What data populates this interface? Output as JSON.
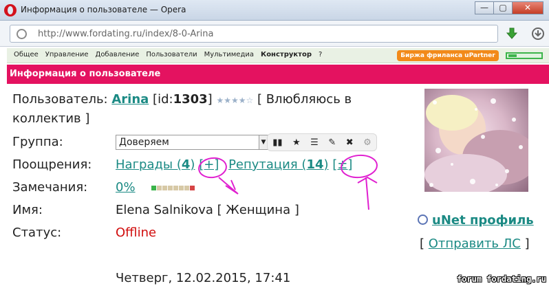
{
  "window": {
    "title": "Информация о пользователе — Opera",
    "buttons": {
      "minimize": "—",
      "maximize": "▢",
      "close": "✕"
    }
  },
  "address_bar": {
    "url": "http://www.fordating.ru/index/8-0-Arina"
  },
  "site_nav": {
    "items": [
      "Общее",
      "Управление",
      "Добавление",
      "Пользователи",
      "Мультимедиа",
      "Конструктор",
      "?"
    ],
    "freelance_label": "Биржа фриланса uPartner"
  },
  "page_header": "Информация о пользователе",
  "profile": {
    "user_label": "Пользователь:",
    "user_name": "Arina",
    "id_prefix": "[id:",
    "id_value": "1303",
    "id_suffix": "]",
    "stars": "★★★★☆",
    "status_line_1": "[ Влюбляюсь в",
    "status_line_2": "коллектив ]",
    "group_label": "Группа:",
    "group_value": "Доверяем",
    "rewards_label": "Поощрения:",
    "awards_text": "Награды (",
    "awards_count": "4",
    "awards_close": ")",
    "awards_add": "[+]",
    "reputation_text": "Репутация (",
    "reputation_count": "14",
    "reputation_close": ")",
    "reputation_adjust": "[±]",
    "remarks_label": "Замечания:",
    "remarks_value": "0%",
    "name_label": "Имя:",
    "name_value": "Elena Salnikova [ Женщина ]",
    "status_label": "Статус:",
    "status_value": "Offline",
    "date_value": "Четверг, 12.02.2015, 17:41",
    "unet_link": "uNet профиль",
    "send_ls_open": "[",
    "send_ls_link": "Отправить ЛС",
    "send_ls_close": "]"
  },
  "mini_toolbar": {
    "icons": [
      "bar-chart-icon",
      "star-icon",
      "list-icon",
      "pencil-icon",
      "close-icon",
      "gear-icon"
    ]
  },
  "watermark": "forum fordating.ru",
  "colors": {
    "accent_pink": "#e41260",
    "link": "#1b8a84",
    "offline": "#d10d0d",
    "annotation": "#e020d0",
    "freelance": "#f28a1a"
  }
}
